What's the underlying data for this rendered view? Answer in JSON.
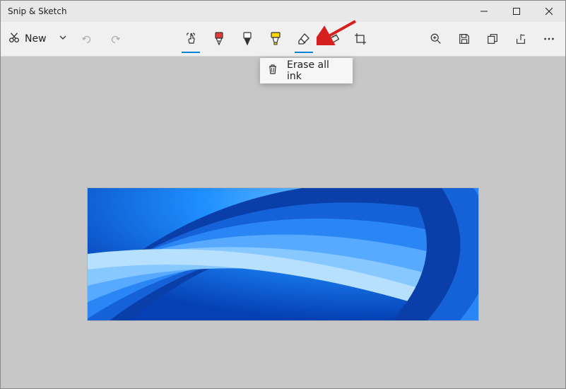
{
  "window": {
    "title": "Snip & Sketch"
  },
  "toolbar": {
    "new_label": "New",
    "touch_writing_selected": true,
    "eraser_selected": true
  },
  "menu": {
    "erase_all_label": "Erase all ink"
  },
  "colors": {
    "accent": "#0a84d6",
    "pen_red": "#e53935",
    "highlighter": "#ffd500"
  }
}
